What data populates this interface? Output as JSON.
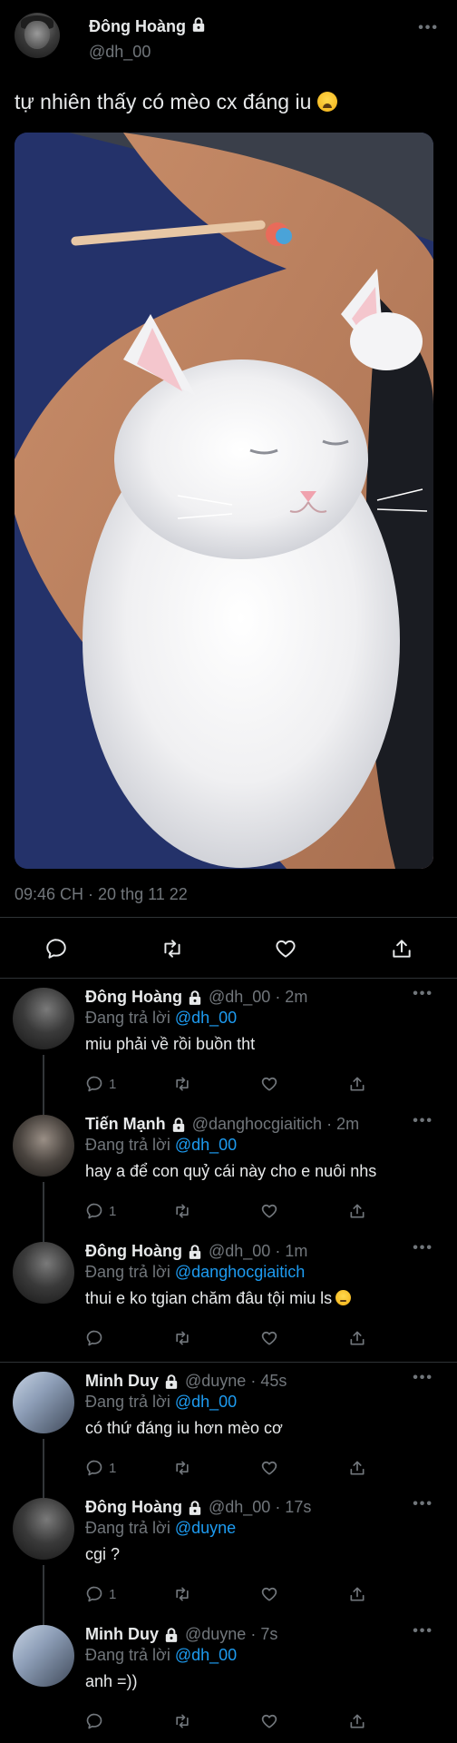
{
  "main_tweet": {
    "author_name": "Đông Hoàng",
    "author_handle": "@dh_00",
    "text": "tự nhiên thấy có mèo cx đáng iu",
    "text_emoji": "weary-face-emoji",
    "timestamp": "09:46 CH · 20 thg 11 22",
    "actions": [
      "reply-icon",
      "retweet-icon",
      "like-icon",
      "share-icon"
    ]
  },
  "replies": [
    {
      "name": "Đông Hoàng",
      "handle": "@dh_00",
      "time": "· 2m",
      "replying_prefix": "Đang trả lời",
      "replying_to": "@dh_00",
      "text": "miu phải về rồi buồn tht",
      "reply_count": "1"
    },
    {
      "name": "Tiến Mạnh",
      "handle": "@danghocgiaitich",
      "time": "· 2m",
      "replying_prefix": "Đang trả lời",
      "replying_to": "@dh_00",
      "text": "hay a để con quỷ cái này cho e nuôi nhs",
      "reply_count": "1"
    },
    {
      "name": "Đông Hoàng",
      "handle": "@dh_00",
      "time": "· 1m",
      "replying_prefix": "Đang trả lời",
      "replying_to": "@danghocgiaitich",
      "text": "thui e ko tgian chăm đâu tội miu ls",
      "text_emoji": "pensive-face-emoji",
      "reply_count": ""
    },
    {
      "name": "Minh Duy",
      "handle": "@duyne",
      "time": "· 45s",
      "replying_prefix": "Đang trả lời",
      "replying_to": "@dh_00",
      "text": "có thứ đáng iu hơn mèo cơ",
      "reply_count": "1"
    },
    {
      "name": "Đông Hoàng",
      "handle": "@dh_00",
      "time": "· 17s",
      "replying_prefix": "Đang trả lời",
      "replying_to": "@duyne",
      "text": "cgi ?",
      "reply_count": "1"
    },
    {
      "name": "Minh Duy",
      "handle": "@duyne",
      "time": "· 7s",
      "replying_prefix": "Đang trả lời",
      "replying_to": "@dh_00",
      "text": "anh =))",
      "reply_count": ""
    }
  ],
  "colors": {
    "background": "#000000",
    "text": "#e7e9ea",
    "muted": "#71767b",
    "link": "#1d9bf0",
    "divider": "#2f3336"
  }
}
